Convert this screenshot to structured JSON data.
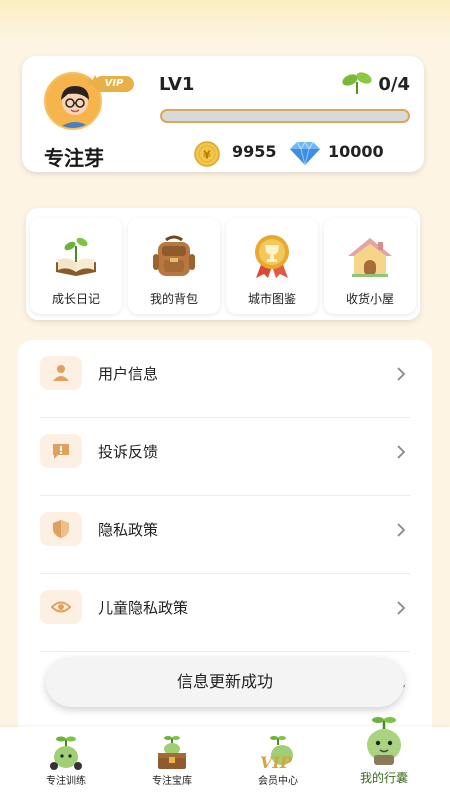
{
  "profile": {
    "username": "专注芽",
    "vip_badge": "VIP",
    "level": "LV1",
    "sprout_progress": "0/4",
    "level_progress_fraction": 0,
    "coins": "9955",
    "gems": "10000"
  },
  "features": [
    {
      "label": "成长日记",
      "icon": "growth-diary-book-icon"
    },
    {
      "label": "我的背包",
      "icon": "backpack-icon"
    },
    {
      "label": "城市图鉴",
      "icon": "city-trophy-medal-icon"
    },
    {
      "label": "收货小屋",
      "icon": "cottage-icon"
    }
  ],
  "menu": [
    {
      "label": "用户信息",
      "icon": "user-icon"
    },
    {
      "label": "投诉反馈",
      "icon": "feedback-icon"
    },
    {
      "label": "隐私政策",
      "icon": "shield-icon"
    },
    {
      "label": "儿童隐私政策",
      "icon": "eye-icon"
    }
  ],
  "toast": {
    "text": "信息更新成功"
  },
  "bottom_nav": [
    {
      "label": "专注训练",
      "icon": "sprout-mascot-icon"
    },
    {
      "label": "专注宝库",
      "icon": "treasure-chest-icon"
    },
    {
      "label": "会员中心",
      "icon": "vip-mascot-icon"
    },
    {
      "label": "我的行囊",
      "icon": "sprout-mascot-icon",
      "active": true
    }
  ],
  "colors": {
    "accent": "#e9a94b",
    "background": "#fdf4e3",
    "menu_icon_bg": "#fdf0e3",
    "menu_icon": "#e0a060",
    "active_tab": "#3a6b1f"
  }
}
